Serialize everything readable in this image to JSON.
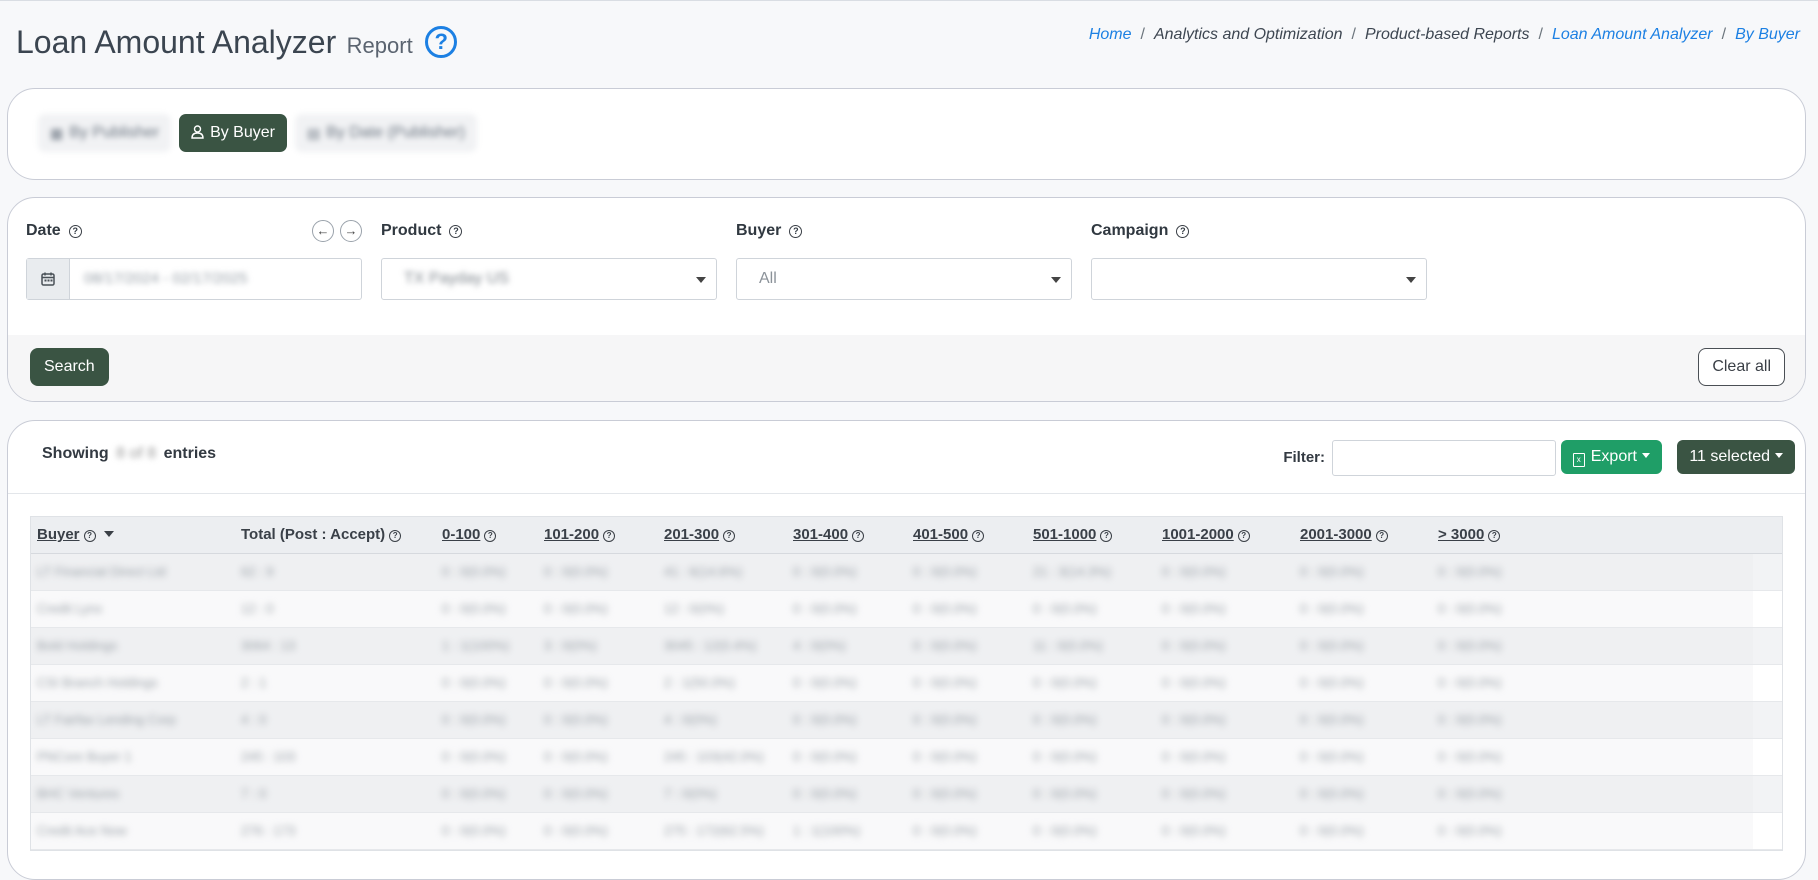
{
  "header": {
    "title": "Loan Amount Analyzer",
    "subtitle": "Report",
    "help_icon": "?"
  },
  "breadcrumb": [
    {
      "label": "Home",
      "link": true
    },
    {
      "label": "Analytics and Optimization",
      "link": false
    },
    {
      "label": "Product-based Reports",
      "link": false
    },
    {
      "label": "Loan Amount Analyzer",
      "link": true
    },
    {
      "label": "By Buyer",
      "link": true
    }
  ],
  "tabs": [
    {
      "label": "By Publisher",
      "icon": "table-icon",
      "active": false
    },
    {
      "label": "By Buyer",
      "icon": "user-icon",
      "active": true
    },
    {
      "label": "By Date (Publisher)",
      "icon": "calendar-icon",
      "active": false
    }
  ],
  "filters": {
    "date": {
      "label": "Date",
      "value": "08/17/2024 - 02/17/2025",
      "prev": "←",
      "next": "→"
    },
    "product": {
      "label": "Product",
      "value": "TX Payday US"
    },
    "buyer": {
      "label": "Buyer",
      "value": "All"
    },
    "campaign": {
      "label": "Campaign",
      "value": ""
    },
    "search_label": "Search",
    "clear_label": "Clear all"
  },
  "table": {
    "showing_prefix": "Showing",
    "showing_count": "8 of 8",
    "showing_suffix": "entries",
    "filter_label": "Filter:",
    "filter_value": "",
    "export_label": "Export",
    "selected_label": "11 selected",
    "columns": [
      "Buyer",
      "Total (Post : Accept)",
      "0-100",
      "101-200",
      "201-300",
      "301-400",
      "401-500",
      "501-1000",
      "1001-2000",
      "2001-3000",
      "> 3000"
    ],
    "rows": [
      [
        "LT Financial Direct Ltd",
        "62 : 9",
        "0 : 0(0.0%)",
        "0 : 0(0.0%)",
        "41 : 6(14.6%)",
        "0 : 0(0.0%)",
        "0 : 0(0.0%)",
        "21 : 3(14.3%)",
        "0 : 0(0.0%)",
        "0 : 0(0.0%)",
        "0 : 0(0.0%)"
      ],
      [
        "Credit Lynx",
        "12 : 0",
        "0 : 0(0.0%)",
        "0 : 0(0.0%)",
        "12 : 0(0%)",
        "0 : 0(0.0%)",
        "0 : 0(0.0%)",
        "0 : 0(0.0%)",
        "0 : 0(0.0%)",
        "0 : 0(0.0%)",
        "0 : 0(0.0%)"
      ],
      [
        "Bold Holdings",
        "3064 : 13",
        "1 : 1(100%)",
        "3 : 0(0%)",
        "3045 : 12(0.4%)",
        "4 : 0(0%)",
        "0 : 0(0.0%)",
        "11 : 0(0.0%)",
        "0 : 0(0.0%)",
        "0 : 0(0.0%)",
        "0 : 0(0.0%)"
      ],
      [
        "CSI Branch Holdings",
        "2 : 1",
        "0 : 0(0.0%)",
        "0 : 0(0.0%)",
        "2 : 1(50.0%)",
        "0 : 0(0.0%)",
        "0 : 0(0.0%)",
        "0 : 0(0.0%)",
        "0 : 0(0.0%)",
        "0 : 0(0.0%)",
        "0 : 0(0.0%)"
      ],
      [
        "LT Fairfax Lending Corp",
        "4 : 0",
        "0 : 0(0.0%)",
        "0 : 0(0.0%)",
        "4 : 0(0%)",
        "0 : 0(0.0%)",
        "0 : 0(0.0%)",
        "0 : 0(0.0%)",
        "0 : 0(0.0%)",
        "0 : 0(0.0%)",
        "0 : 0(0.0%)"
      ],
      [
        "PNCore Buyer 1",
        "245 : 103",
        "0 : 0(0.0%)",
        "0 : 0(0.0%)",
        "245 : 103(42.0%)",
        "0 : 0(0.0%)",
        "0 : 0(0.0%)",
        "0 : 0(0.0%)",
        "0 : 0(0.0%)",
        "0 : 0(0.0%)",
        "0 : 0(0.0%)"
      ],
      [
        "BHC Ventures",
        "7 : 0",
        "0 : 0(0.0%)",
        "0 : 0(0.0%)",
        "7 : 0(0%)",
        "0 : 0(0.0%)",
        "0 : 0(0.0%)",
        "0 : 0(0.0%)",
        "0 : 0(0.0%)",
        "0 : 0(0.0%)",
        "0 : 0(0.0%)"
      ],
      [
        "Credit Ace Now",
        "276 : 173",
        "0 : 0(0.0%)",
        "0 : 0(0.0%)",
        "275 : 172(62.5%)",
        "1 : 1(100%)",
        "0 : 0(0.0%)",
        "0 : 0(0.0%)",
        "0 : 0(0.0%)",
        "0 : 0(0.0%)",
        "0 : 0(0.0%)"
      ]
    ]
  }
}
